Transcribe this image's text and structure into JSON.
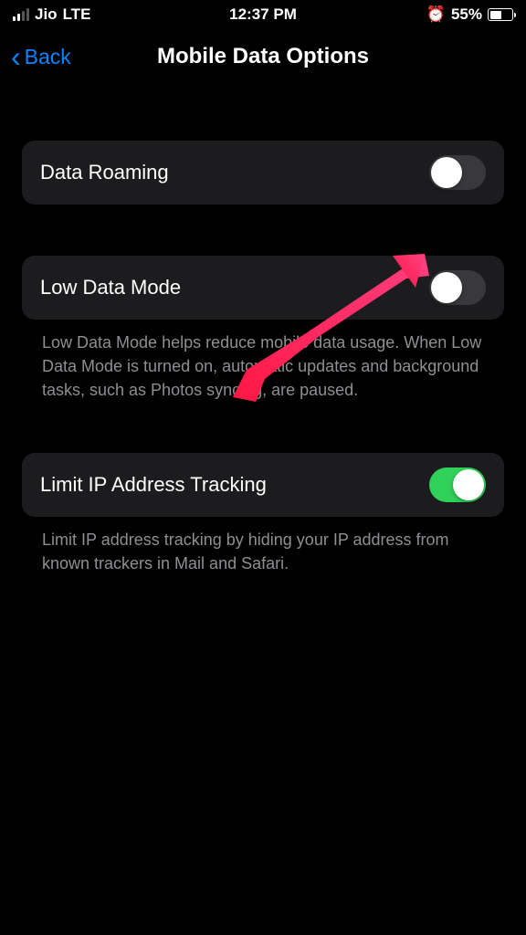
{
  "status_bar": {
    "carrier": "Jio",
    "network_type": "LTE",
    "time": "12:37 PM",
    "battery_percent": "55%",
    "battery_fill_width": "55%"
  },
  "nav": {
    "back_label": "Back",
    "title": "Mobile Data Options"
  },
  "settings": {
    "data_roaming": {
      "label": "Data Roaming"
    },
    "low_data_mode": {
      "label": "Low Data Mode",
      "description": "Low Data Mode helps reduce mobile data usage. When Low Data Mode is turned on, automatic updates and background tasks, such as Photos syncing, are paused."
    },
    "limit_ip_tracking": {
      "label": "Limit IP Address Tracking",
      "description": "Limit IP address tracking by hiding your IP address from known trackers in Mail and Safari."
    }
  }
}
